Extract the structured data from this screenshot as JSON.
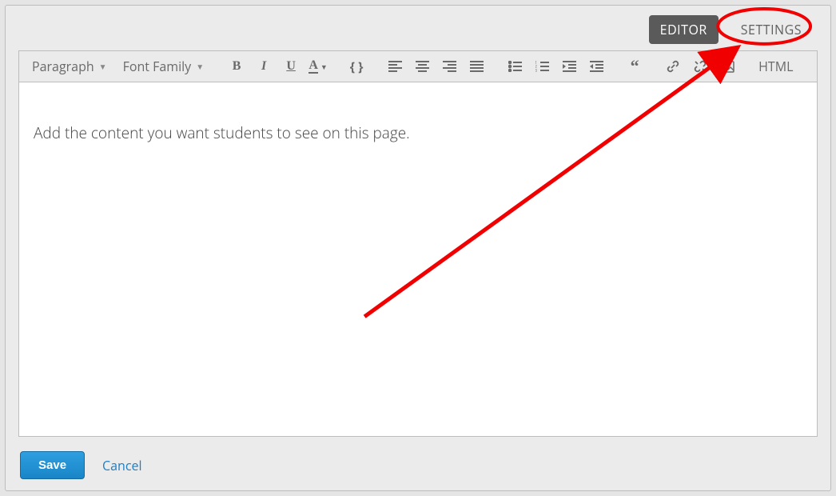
{
  "tabs": {
    "editor": "EDITOR",
    "settings": "SETTINGS"
  },
  "toolbar": {
    "paragraph": "Paragraph",
    "font_family": "Font Family",
    "html": "HTML"
  },
  "editor": {
    "placeholder": "Add the content you want students to see on this page."
  },
  "footer": {
    "save": "Save",
    "cancel": "Cancel"
  }
}
